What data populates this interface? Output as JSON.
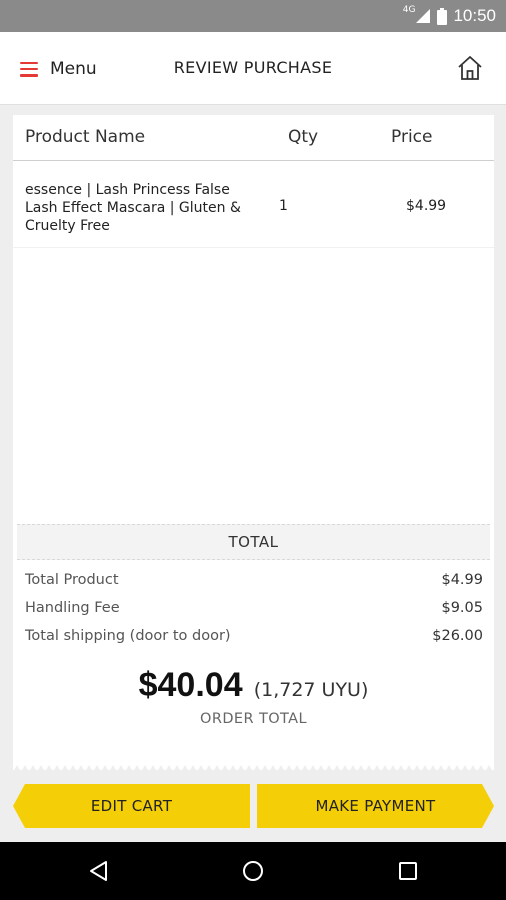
{
  "status_bar": {
    "network": "4G",
    "time": "10:50"
  },
  "app_bar": {
    "menu_label": "Menu",
    "title": "REVIEW PURCHASE"
  },
  "table": {
    "headers": {
      "product": "Product Name",
      "qty": "Qty",
      "price": "Price"
    },
    "rows": [
      {
        "name": "essence | Lash Princess False Lash Effect Mascara | Gluten & Cruelty Free",
        "qty": "1",
        "price": "$4.99"
      }
    ]
  },
  "totals": {
    "band_label": "TOTAL",
    "lines": [
      {
        "label": "Total Product",
        "amount": "$4.99"
      },
      {
        "label": "Handling Fee",
        "amount": "$9.05"
      },
      {
        "label": "Total shipping (door to door)",
        "amount": "$26.00"
      }
    ],
    "grand_total": "$40.04",
    "local_total": "(1,727 UYU)",
    "order_total_label": "ORDER TOTAL"
  },
  "actions": {
    "edit_cart": "EDIT CART",
    "make_payment": "MAKE PAYMENT"
  },
  "colors": {
    "accent_yellow": "#f4cf08",
    "menu_red": "#e53935"
  }
}
